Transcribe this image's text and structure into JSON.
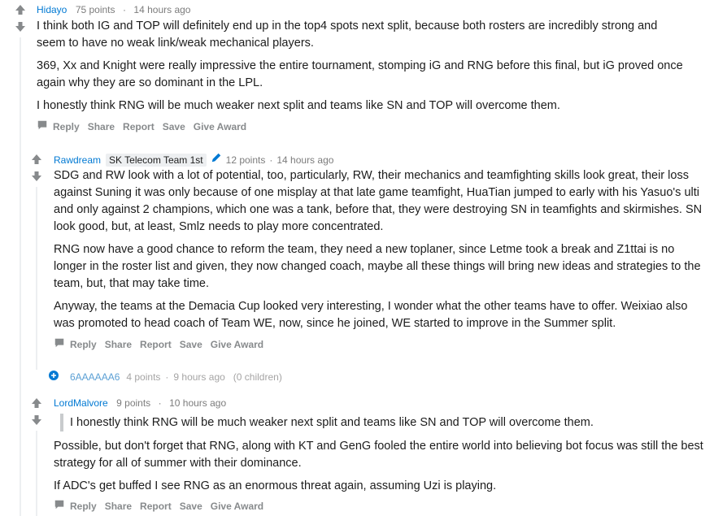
{
  "comments": [
    {
      "author": "Hidayo",
      "points": "75 points",
      "time": "14 hours ago",
      "paragraphs": [
        "I think both IG and TOP will definitely end up in the top4 spots next split, because both rosters are incredibly strong and seem to have no weak link/weak mechanical players.",
        "369, Xx and Knight were really impressive the entire tournament, stomping iG and RNG before this final, but iG proved once again why they are so dominant in the LPL.",
        "I honestly think RNG will be much weaker next split and teams like SN and TOP will overcome them."
      ],
      "actions": [
        "Reply",
        "Share",
        "Report",
        "Save",
        "Give Award"
      ]
    },
    {
      "author": "Rawdream",
      "flair": "SK Telecom Team 1st",
      "points": "12 points",
      "time": "14 hours ago",
      "paragraphs": [
        "SDG and RW look with a lot of potential, too, particularly, RW, their mechanics and teamfighting skills look great, their loss against Suning it was only because of one misplay at that late game teamfight, HuaTian jumped to early with his Yasuo's ulti and only against 2 champions, which one was a tank, before that, they were destroying SN in teamfights and skirmishes. SN look good, but, at least, Smlz needs to play more concentrated.",
        "RNG now have a good chance to reform the team, they need a new toplaner, since Letme took a break and Z1ttai is no longer in the roster list and given, they now changed coach, maybe all these things will bring new ideas and strategies to the team, but, that may take time.",
        "Anyway, the teams at the Demacia Cup looked very interesting, I wonder what the other teams have to offer. Weixiao also was promoted to head coach of Team WE, now, since he joined, WE started to improve in the Summer split."
      ],
      "actions": [
        "Reply",
        "Share",
        "Report",
        "Save",
        "Give Award"
      ]
    },
    {
      "author": "6AAAAAA6",
      "points": "4 points",
      "time": "9 hours ago",
      "children": "(0 children)"
    },
    {
      "author": "LordMalvore",
      "points": "9 points",
      "time": "10 hours ago",
      "quote": "I honestly think RNG will be much weaker next split and teams like SN and TOP will overcome them.",
      "paragraphs": [
        "Possible, but don't forget that RNG, along with KT and GenG fooled the entire world into believing bot focus was still the best strategy for all of summer with their dominance.",
        "If ADC's get buffed I see RNG as an enormous threat again, assuming Uzi is playing."
      ],
      "actions": [
        "Reply",
        "Share",
        "Report",
        "Save",
        "Give Award"
      ]
    }
  ],
  "icons": {
    "upvote": "upvote-arrow-icon",
    "downvote": "downvote-arrow-icon",
    "comment": "comment-bubble-icon",
    "pencil": "pencil-icon",
    "expand": "expand-plus-icon"
  }
}
